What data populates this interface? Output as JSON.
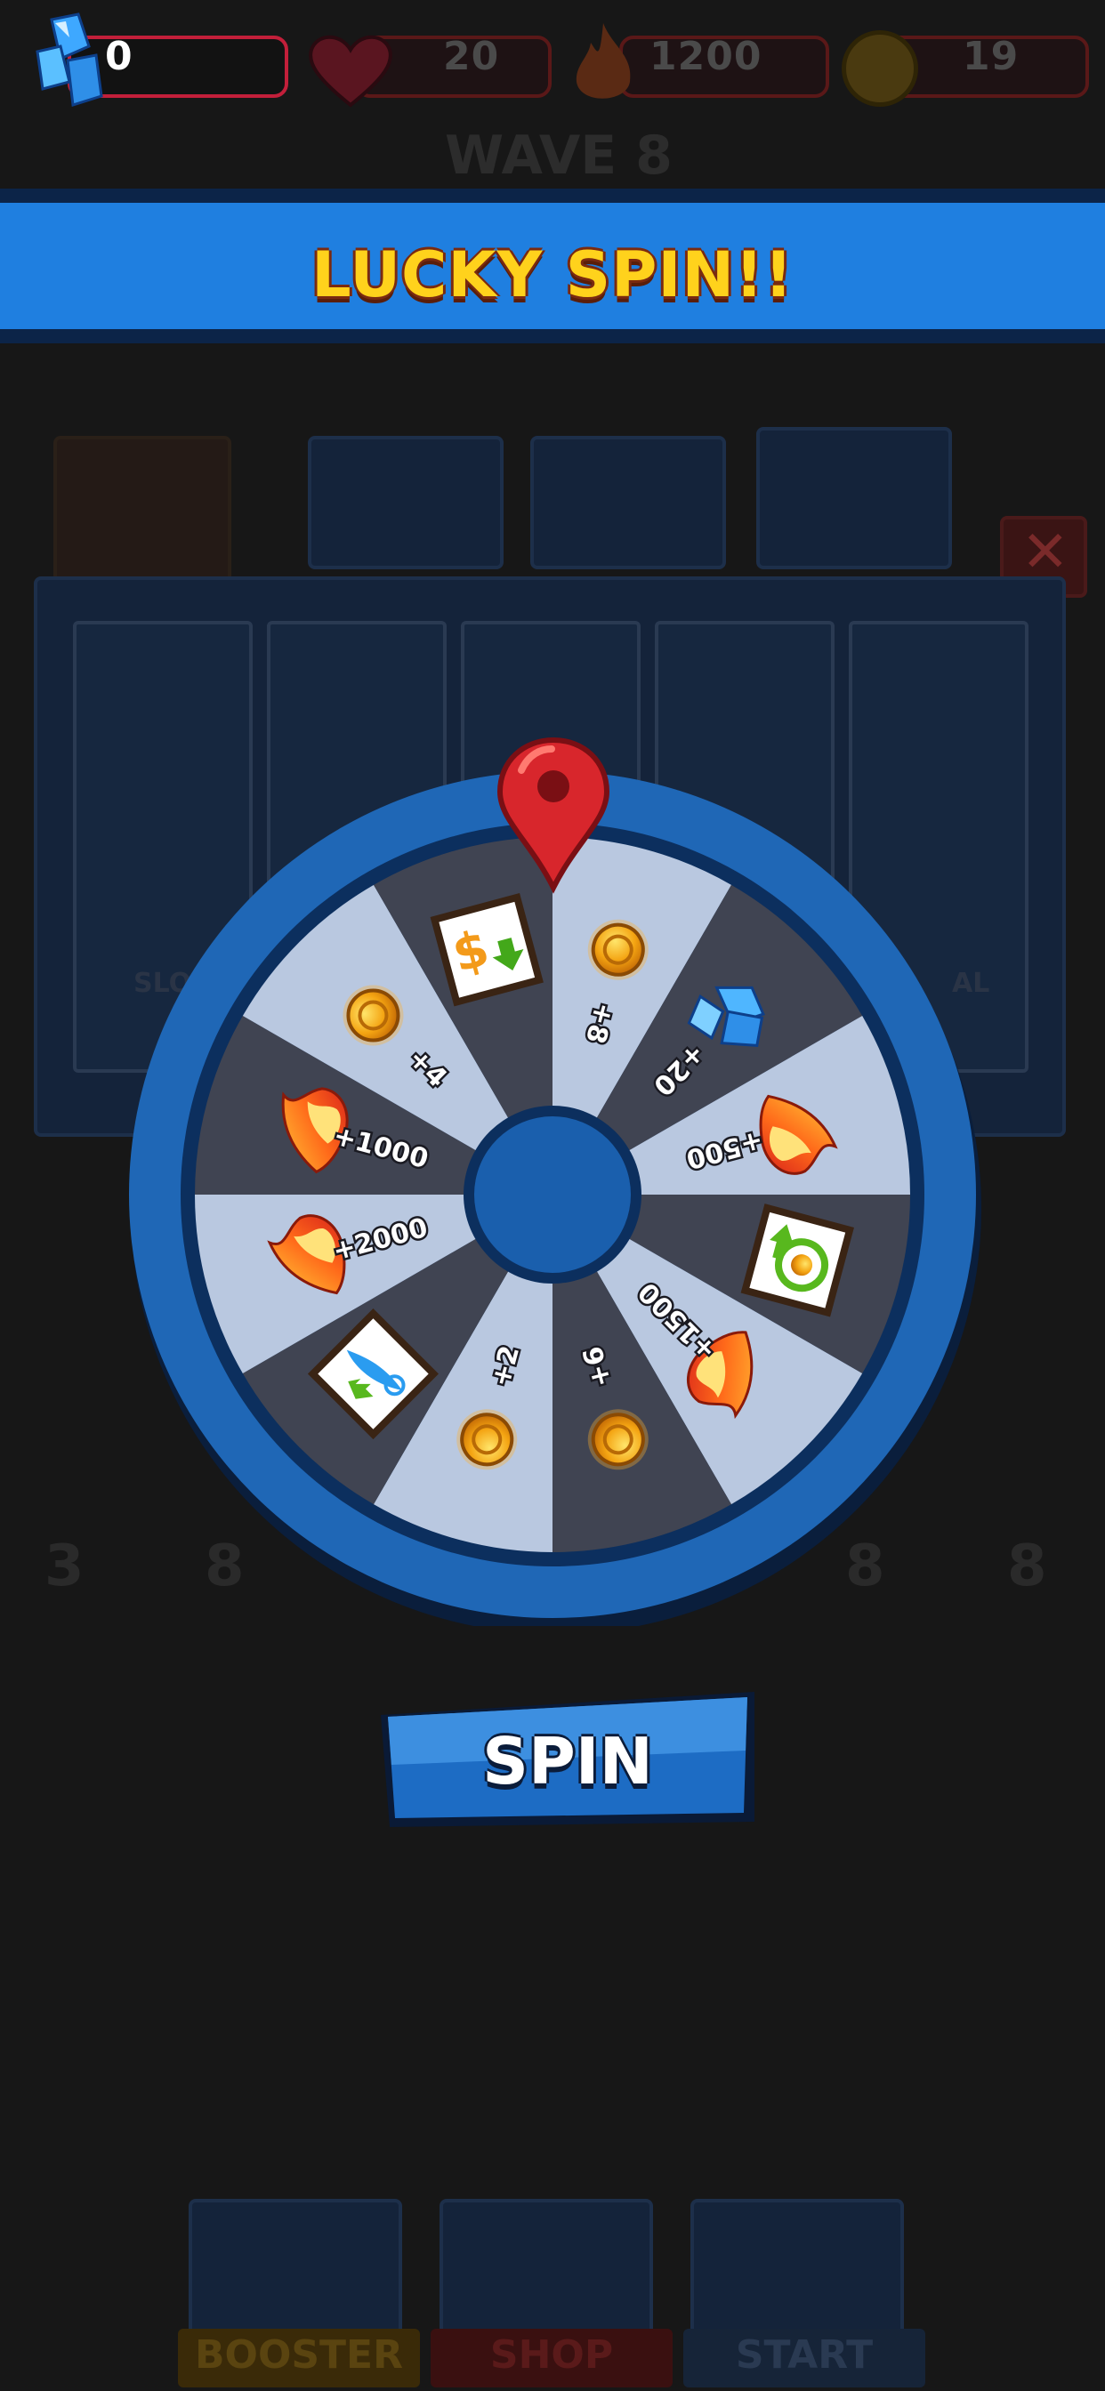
{
  "hud": {
    "gems": "0",
    "lives": "20",
    "fire": "1200",
    "coins": "19"
  },
  "background": {
    "wave_label": "WAVE 8",
    "hero_labels": [
      "SLO",
      "AL"
    ],
    "levels": [
      "3",
      "8",
      "8",
      "8"
    ]
  },
  "banner": {
    "title": "LUCKY SPIN!!"
  },
  "wheel": {
    "segments": [
      {
        "reward": "+8",
        "icon": "gold-coin-icon"
      },
      {
        "reward": "+20",
        "icon": "blue-gem-icon"
      },
      {
        "reward": "+500",
        "icon": "fire-icon"
      },
      {
        "reward": "",
        "icon": "refresh-card-icon"
      },
      {
        "reward": "+1500",
        "icon": "fire-icon"
      },
      {
        "reward": "+6",
        "icon": "gold-coin-icon"
      },
      {
        "reward": "+2",
        "icon": "gold-coin-icon"
      },
      {
        "reward": "",
        "icon": "freeze-card-icon"
      },
      {
        "reward": "+2000",
        "icon": "fire-icon"
      },
      {
        "reward": "+1000",
        "icon": "fire-icon"
      },
      {
        "reward": "+4",
        "icon": "gold-coin-icon"
      },
      {
        "reward": "",
        "icon": "price-down-card-icon"
      }
    ],
    "colors": {
      "light": "#b9c8e0",
      "dark": "#404452",
      "rim": "#1f67b6",
      "hub": "#1a5fad"
    }
  },
  "spin_button": {
    "label": "SPIN"
  },
  "bottom_nav": {
    "booster": "BOOSTER",
    "shop": "SHOP",
    "start": "START"
  },
  "colors": {
    "accent": "#1f7fe0",
    "banner_text": "#ffd21c",
    "pin": "#d8262c"
  }
}
